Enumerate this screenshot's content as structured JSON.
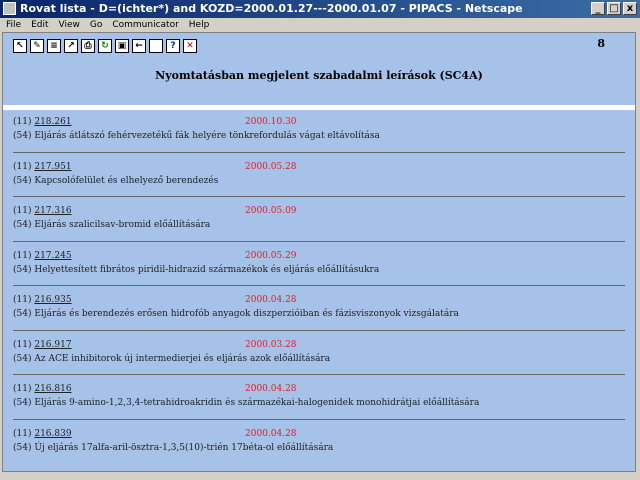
{
  "window": {
    "title": "Rovat lista - D=(ichter*) and KOZD=2000.01.27---2000.01.07 - PIPACS - Netscape",
    "buttons": [
      "_",
      "□",
      "x"
    ]
  },
  "menu": [
    "File",
    "Edit",
    "View",
    "Go",
    "Communicator",
    "Help"
  ],
  "toolbar": {
    "icons": [
      {
        "name": "pointer-icon",
        "glyph": "↖"
      },
      {
        "name": "edit-icon",
        "glyph": "✎"
      },
      {
        "name": "form-icon",
        "glyph": "≡"
      },
      {
        "name": "chart-icon",
        "glyph": "↗"
      },
      {
        "name": "print-icon",
        "glyph": "⎙"
      },
      {
        "name": "refresh-icon",
        "glyph": "↻"
      },
      {
        "name": "lock-icon",
        "glyph": "▣"
      },
      {
        "name": "arrow-icon",
        "glyph": "←"
      },
      {
        "name": "blank-icon",
        "glyph": ""
      },
      {
        "name": "help-icon",
        "glyph": "?"
      },
      {
        "name": "close-icon",
        "glyph": "✕"
      }
    ],
    "icon_colors": {
      "close-icon": "#cc0000",
      "help-icon": "#003399",
      "refresh-icon": "#008800"
    }
  },
  "page_number": "8",
  "heading": "Nyomtatásban megjelent szabadalmi leírások (SC4A)",
  "records": [
    {
      "num": "(11)",
      "id": "218.261",
      "date": "2000.10.30",
      "code": "(54)",
      "desc": "Eljárás átlátszó fehérvezetékű fák helyére tönkrefordulás vágat eltávolítása"
    },
    {
      "num": "(11)",
      "id": "217.951",
      "date": "2000.05.28",
      "code": "(54)",
      "desc": "Kapcsolófelület és elhelyező berendezés"
    },
    {
      "num": "(11)",
      "id": "217.316",
      "date": "2000.05.09",
      "code": "(54)",
      "desc": "Eljárás szalicilsav-bromid előállítására"
    },
    {
      "num": "(11)",
      "id": "217.245",
      "date": "2000.05.29",
      "code": "(54)",
      "desc": "Helyettesített fibrátos piridil-hidrazid származékok és eljárás előállításukra"
    },
    {
      "num": "(11)",
      "id": "216.935",
      "date": "2000.04.28",
      "code": "(54)",
      "desc": "Eljárás és berendezés erősen hidrofób anyagok diszperzióiban és fázisviszonyok vizsgálatára"
    },
    {
      "num": "(11)",
      "id": "216.917",
      "date": "2000.03.28",
      "code": "(54)",
      "desc": "Az ACE inhibitorok új intermedierjei és eljárás azok előállítására"
    },
    {
      "num": "(11)",
      "id": "216.816",
      "date": "2000.04.28",
      "code": "(54)",
      "desc": "Eljárás 9-amino-1,2,3,4-tetrahidroakridin és származékai-halogenidek monohidrátjai előállítására"
    },
    {
      "num": "(11)",
      "id": "216.839",
      "date": "2000.04.28",
      "code": "(54)",
      "desc": "Új eljárás 17alfa-aril-ösztra-1,3,5(10)-trién 17béta-ol előállítására"
    }
  ]
}
